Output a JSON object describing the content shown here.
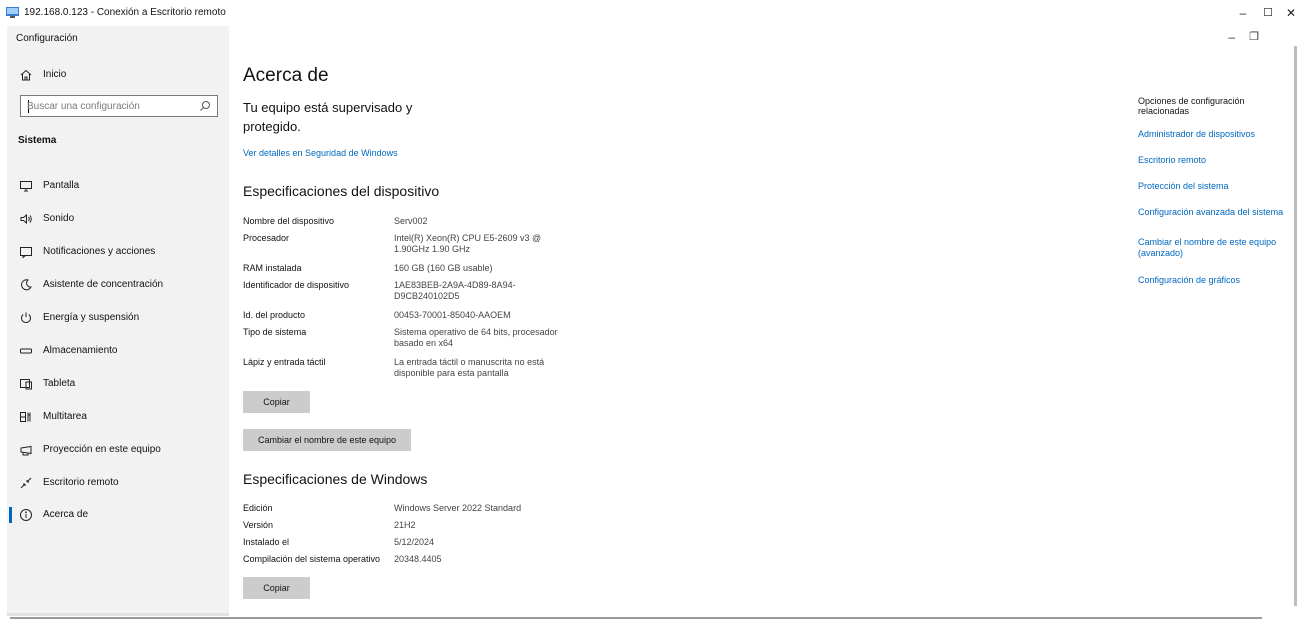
{
  "rdp": {
    "title": "192.168.0.123 - Conexión a Escritorio remoto",
    "buttons": {
      "minimize": "–",
      "maximize": "☐",
      "close": "✕"
    }
  },
  "app": {
    "title": "Configuración",
    "window_buttons": {
      "minimize": "–",
      "restore": "❐"
    }
  },
  "sidebar": {
    "home_label": "Inicio",
    "search_placeholder": "Buscar una configuración",
    "section": "Sistema",
    "items": [
      {
        "label": "Pantalla",
        "icon": "monitor-icon"
      },
      {
        "label": "Sonido",
        "icon": "speaker-icon"
      },
      {
        "label": "Notificaciones y acciones",
        "icon": "notification-icon"
      },
      {
        "label": "Asistente de concentración",
        "icon": "moon-icon"
      },
      {
        "label": "Energía y suspensión",
        "icon": "power-icon"
      },
      {
        "label": "Almacenamiento",
        "icon": "storage-icon"
      },
      {
        "label": "Tableta",
        "icon": "tablet-icon"
      },
      {
        "label": "Multitarea",
        "icon": "multitask-icon"
      },
      {
        "label": "Proyección en este equipo",
        "icon": "projection-icon"
      },
      {
        "label": "Escritorio remoto",
        "icon": "remote-desktop-icon"
      },
      {
        "label": "Acerca de",
        "icon": "info-icon",
        "selected": true
      }
    ]
  },
  "main": {
    "title": "Acerca de",
    "protected_text": "Tu equipo está supervisado y protegido.",
    "security_link": "Ver detalles en Seguridad de Windows",
    "device_specs_title": "Especificaciones del dispositivo",
    "device_specs": [
      {
        "key": "Nombre del dispositivo",
        "value": "Serv002"
      },
      {
        "key": "Procesador",
        "value": "Intel(R) Xeon(R) CPU E5-2609 v3 @ 1.90GHz   1.90 GHz"
      },
      {
        "key": "RAM instalada",
        "value": "160 GB (160 GB usable)"
      },
      {
        "key": "Identificador de dispositivo",
        "value": "1AE83BEB-2A9A-4D89-8A94-D9CB240102D5"
      },
      {
        "key": "Id. del producto",
        "value": "00453-70001-85040-AAOEM"
      },
      {
        "key": "Tipo de sistema",
        "value": "Sistema operativo de 64 bits, procesador basado en x64"
      },
      {
        "key": "Lápiz y entrada táctil",
        "value": "La entrada táctil o manuscrita no está disponible para esta pantalla"
      }
    ],
    "copy_label": "Copiar",
    "rename_label": "Cambiar el nombre de este equipo",
    "windows_specs_title": "Especificaciones de Windows",
    "windows_specs": [
      {
        "key": "Edición",
        "value": "Windows Server 2022 Standard"
      },
      {
        "key": "Versión",
        "value": "21H2"
      },
      {
        "key": "Instalado el",
        "value": "5/12/2024"
      },
      {
        "key": "Compilación del sistema operativo",
        "value": "20348.4405"
      }
    ],
    "copy2_label": "Copiar"
  },
  "related": {
    "header": "Opciones de configuración relacionadas",
    "links": [
      "Administrador de dispositivos",
      "Escritorio remoto",
      "Protección del sistema",
      "Configuración avanzada del sistema",
      "Cambiar el nombre de este equipo (avanzado)",
      "Configuración de gráficos"
    ]
  },
  "colors": {
    "accent": "#0067c0",
    "sidebar_bg": "#f2f2f2",
    "button_bg": "#cccccc"
  }
}
